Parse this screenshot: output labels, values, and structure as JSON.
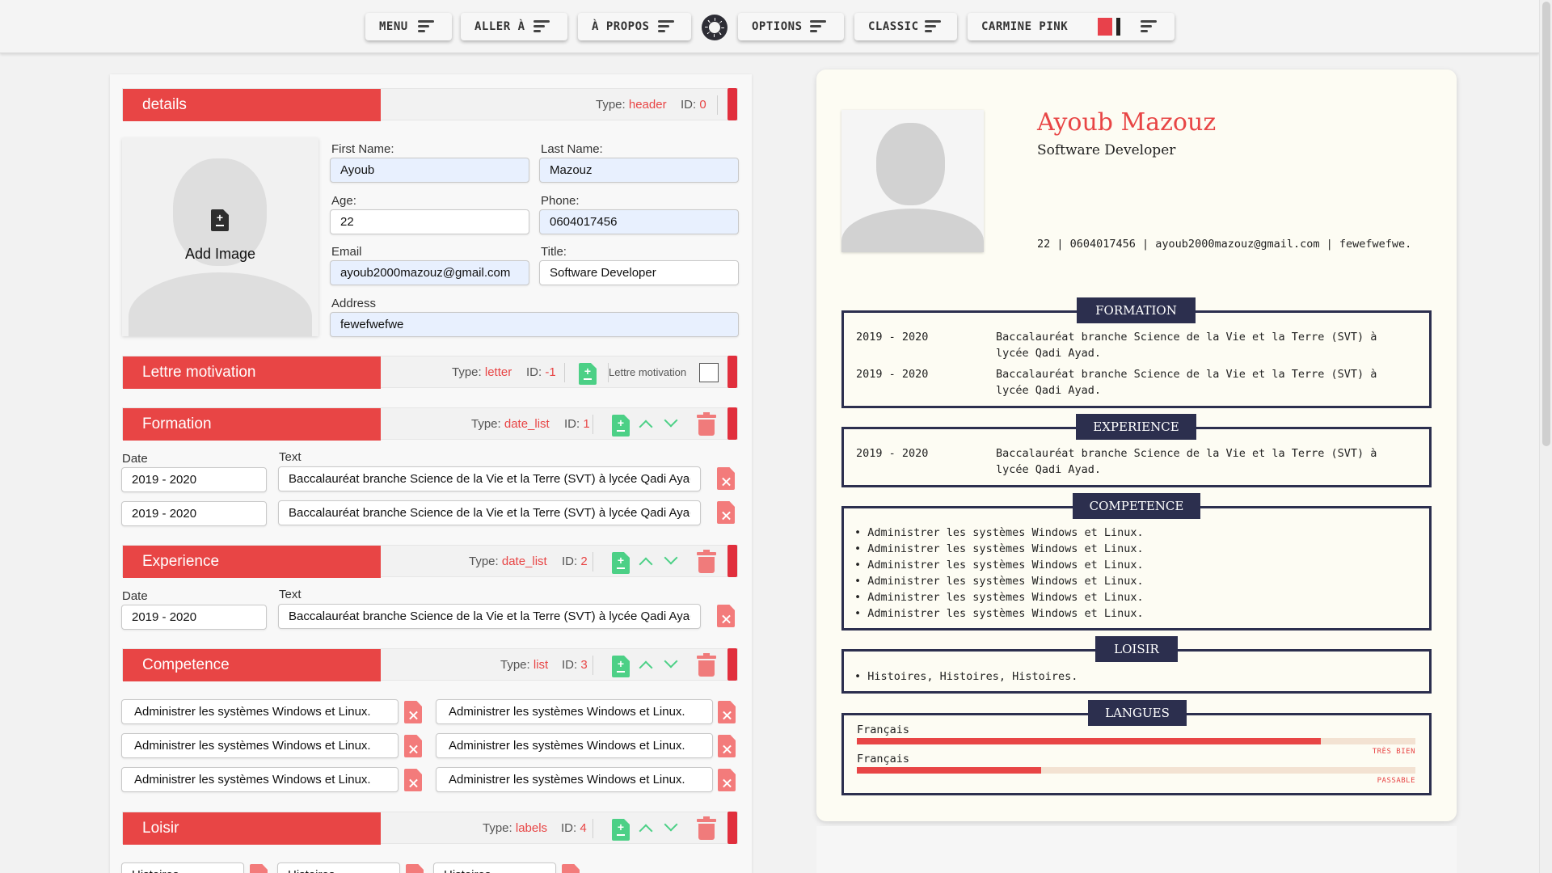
{
  "topbar": {
    "menu_label": "MENU",
    "goto_label": "ALLER À",
    "about_label": "À PROPOS",
    "options_label": "OPTIONS",
    "template_label": "CLASSIC",
    "theme_label": "CARMINE PINK",
    "theme_colors": [
      "#e8414b",
      "#f5f5f5",
      "#222222"
    ]
  },
  "editor": {
    "sections": [
      {
        "label": "details",
        "type_label": "Type:",
        "type": "header",
        "id_label": "ID:",
        "id": "0"
      },
      {
        "label": "Lettre motivation",
        "type_label": "Type:",
        "type": "letter",
        "id_label": "ID:",
        "id": "-1",
        "toggle_label": "Lettre motivation"
      },
      {
        "label": "Formation",
        "type_label": "Type:",
        "type": "date_list",
        "id_label": "ID:",
        "id": "1"
      },
      {
        "label": "Experience",
        "type_label": "Type:",
        "type": "date_list",
        "id_label": "ID:",
        "id": "2"
      },
      {
        "label": "Competence",
        "type_label": "Type:",
        "type": "list",
        "id_label": "ID:",
        "id": "3"
      },
      {
        "label": "Loisir",
        "type_label": "Type:",
        "type": "labels",
        "id_label": "ID:",
        "id": "4"
      }
    ],
    "details": {
      "add_image_label": "Add Image",
      "fields": {
        "first_name": {
          "label": "First Name:",
          "value": "Ayoub"
        },
        "last_name": {
          "label": "Last Name:",
          "value": "Mazouz"
        },
        "age": {
          "label": "Age:",
          "value": "22"
        },
        "phone": {
          "label": "Phone:",
          "value": "0604017456"
        },
        "email": {
          "label": "Email",
          "value": "ayoub2000mazouz@gmail.com"
        },
        "title": {
          "label": "Title:",
          "value": "Software Developer"
        },
        "address": {
          "label": "Address",
          "value": "fewefwefwe"
        }
      }
    },
    "date_label": "Date",
    "text_label": "Text",
    "formation_rows": [
      {
        "date": "2019 - 2020",
        "text": "Baccalauréat branche Science de la Vie et la Terre (SVT) à lycée Qadi Ayad."
      },
      {
        "date": "2019 - 2020",
        "text": "Baccalauréat branche Science de la Vie et la Terre (SVT) à lycée Qadi Ayad."
      }
    ],
    "experience_rows": [
      {
        "date": "2019 - 2020",
        "text": "Baccalauréat branche Science de la Vie et la Terre (SVT) à lycée Qadi Ayad."
      }
    ],
    "competence_items": [
      "Administrer les systèmes Windows et Linux.",
      "Administrer les systèmes Windows et Linux.",
      "Administrer les systèmes Windows et Linux.",
      "Administrer les systèmes Windows et Linux.",
      "Administrer les systèmes Windows et Linux.",
      "Administrer les systèmes Windows et Linux."
    ],
    "loisir_items": [
      "Histoires",
      "Histoires",
      "Histoires"
    ]
  },
  "preview": {
    "name": "Ayoub Mazouz",
    "title": "Software Developer",
    "info_line": "22 | 0604017456 | ayoub2000mazouz@gmail.com | fewefwefwe.",
    "formation": {
      "heading": "FORMATION",
      "rows": [
        {
          "date": "2019 - 2020",
          "line1": "Baccalauréat branche Science de la Vie et la Terre (SVT) à",
          "line2": "lycée Qadi Ayad."
        },
        {
          "date": "2019 - 2020",
          "line1": "Baccalauréat branche Science de la Vie et la Terre (SVT) à",
          "line2": "lycée Qadi Ayad."
        }
      ]
    },
    "experience": {
      "heading": "EXPERIENCE",
      "rows": [
        {
          "date": "2019 - 2020",
          "line1": "Baccalauréat branche Science de la Vie et la Terre (SVT) à",
          "line2": "lycée Qadi Ayad."
        }
      ]
    },
    "competence": {
      "heading": "COMPETENCE",
      "items": [
        "Administrer les systèmes Windows et Linux.",
        "Administrer les systèmes Windows et Linux.",
        "Administrer les systèmes Windows et Linux.",
        "Administrer les systèmes Windows et Linux.",
        "Administrer les systèmes Windows et Linux.",
        "Administrer les systèmes Windows et Linux."
      ]
    },
    "loisir": {
      "heading": "LOISIR",
      "line": "Histoires, Histoires, Histoires."
    },
    "langues": {
      "heading": "LANGUES",
      "items": [
        {
          "name": "Français",
          "level": "TRÈS BIEN",
          "fraction": 0.83
        },
        {
          "name": "Français",
          "level": "PASSABLE",
          "fraction": 0.33
        }
      ]
    }
  },
  "colors": {
    "accent": "#e84545",
    "accent_dark": "#e12f3d",
    "navy": "#2c2f4e",
    "success": "#4cd086",
    "danger_light": "#f37b7b"
  }
}
